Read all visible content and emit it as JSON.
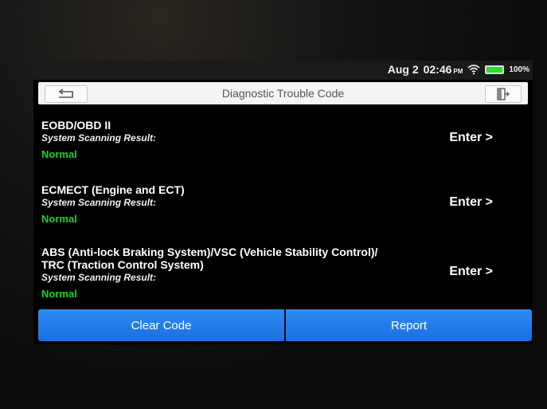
{
  "status": {
    "date": "Aug 2",
    "time": "02:46",
    "ampm": "PM",
    "battery": "100%",
    "battery_color": "#24e12a"
  },
  "header": {
    "title": "Diagnostic Trouble Code"
  },
  "systems": [
    {
      "name": "EOBD/OBD II",
      "label": "System Scanning Result:",
      "result": "Normal",
      "enter": "Enter >"
    },
    {
      "name": "ECMECT (Engine and ECT)",
      "label": "System Scanning Result:",
      "result": "Normal",
      "enter": "Enter >"
    },
    {
      "name_line1": "ABS (Anti-lock Braking System)/VSC (Vehicle Stability Control)/",
      "name_line2": "TRC (Traction Control System)",
      "label": "System Scanning Result:",
      "result": "Normal",
      "enter": "Enter >"
    }
  ],
  "actions": {
    "clear_label": "Clear Code",
    "report_label": "Report",
    "accent": "#1f7ae8"
  },
  "icons": {
    "back": "back-arrow-icon",
    "exit": "exit-icon",
    "wifi": "wifi-icon",
    "battery": "battery-icon"
  }
}
